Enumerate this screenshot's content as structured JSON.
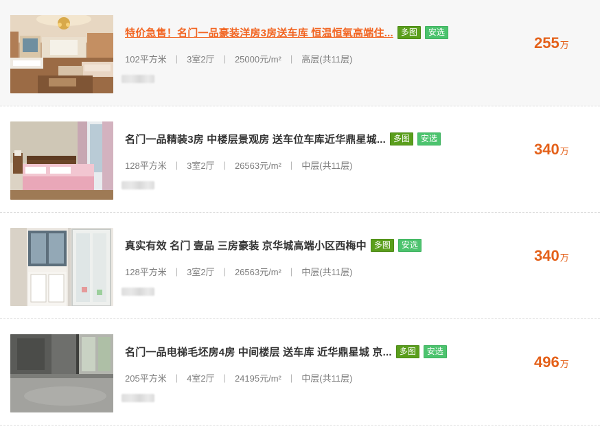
{
  "listings": [
    {
      "title": "特价急售！名门一品豪装洋房3房送车库 恒温恒氧高端住...",
      "badges": {
        "multi": "多图",
        "anxuan": "安选"
      },
      "area": "102平方米",
      "layout": "3室2厅",
      "unit_price": "25000元/m²",
      "floor": "高层(共11层)",
      "price": "255",
      "price_unit": "万"
    },
    {
      "title": "名门一品精装3房 中楼层景观房 送车位车库近华鼎星城...",
      "badges": {
        "multi": "多图",
        "anxuan": "安选"
      },
      "area": "128平方米",
      "layout": "3室2厅",
      "unit_price": "26563元/m²",
      "floor": "中层(共11层)",
      "price": "340",
      "price_unit": "万"
    },
    {
      "title": "真实有效 名门 壹品 三房豪装 京华城高端小区西梅中",
      "badges": {
        "multi": "多图",
        "anxuan": "安选"
      },
      "area": "128平方米",
      "layout": "3室2厅",
      "unit_price": "26563元/m²",
      "floor": "中层(共11层)",
      "price": "340",
      "price_unit": "万"
    },
    {
      "title": "名门一品电梯毛坯房4房 中间楼层 送车库 近华鼎星城 京...",
      "badges": {
        "multi": "多图",
        "anxuan": "安选"
      },
      "area": "205平方米",
      "layout": "4室2厅",
      "unit_price": "24195元/m²",
      "floor": "中层(共11层)",
      "price": "496",
      "price_unit": "万"
    }
  ]
}
